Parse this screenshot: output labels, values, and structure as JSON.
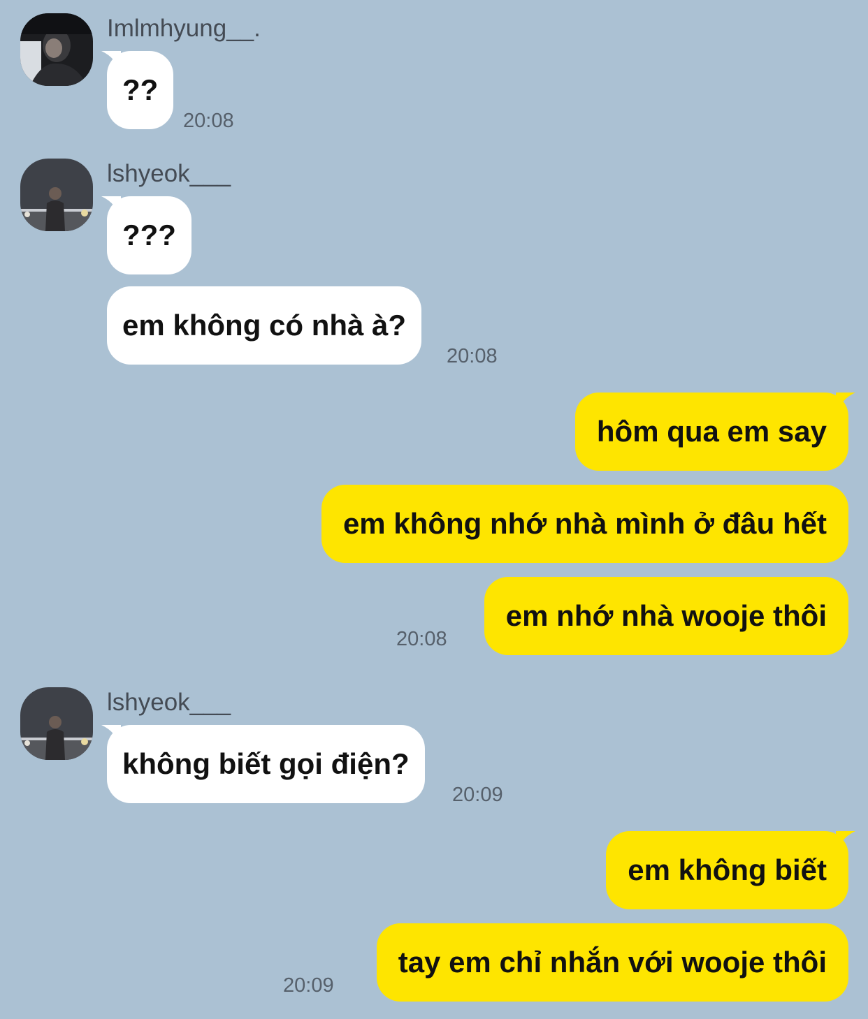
{
  "messages": [
    {
      "sender": "Imlmhyung__.",
      "text": "??",
      "time": "20:08"
    },
    {
      "sender": "lshyeok___",
      "text": "???"
    },
    {
      "sender": "lshyeok___",
      "text": "em không có nhà à?",
      "time": "20:08"
    },
    {
      "sender": "me",
      "text": "hôm qua em say"
    },
    {
      "sender": "me",
      "text": "em không nhớ nhà mình ở đâu hết"
    },
    {
      "sender": "me",
      "text": "em nhớ nhà wooje thôi",
      "time": "20:08"
    },
    {
      "sender": "lshyeok___",
      "text": "không biết gọi điện?",
      "time": "20:09"
    },
    {
      "sender": "me",
      "text": "em không biết"
    },
    {
      "sender": "me",
      "text": "tay em chỉ nhắn với wooje thôi",
      "time": "20:09"
    }
  ],
  "colors": {
    "background": "#abc1d3",
    "incoming_bubble": "#ffffff",
    "outgoing_bubble": "#fee500",
    "timestamp": "#56606b",
    "sender_name": "#444b54"
  }
}
